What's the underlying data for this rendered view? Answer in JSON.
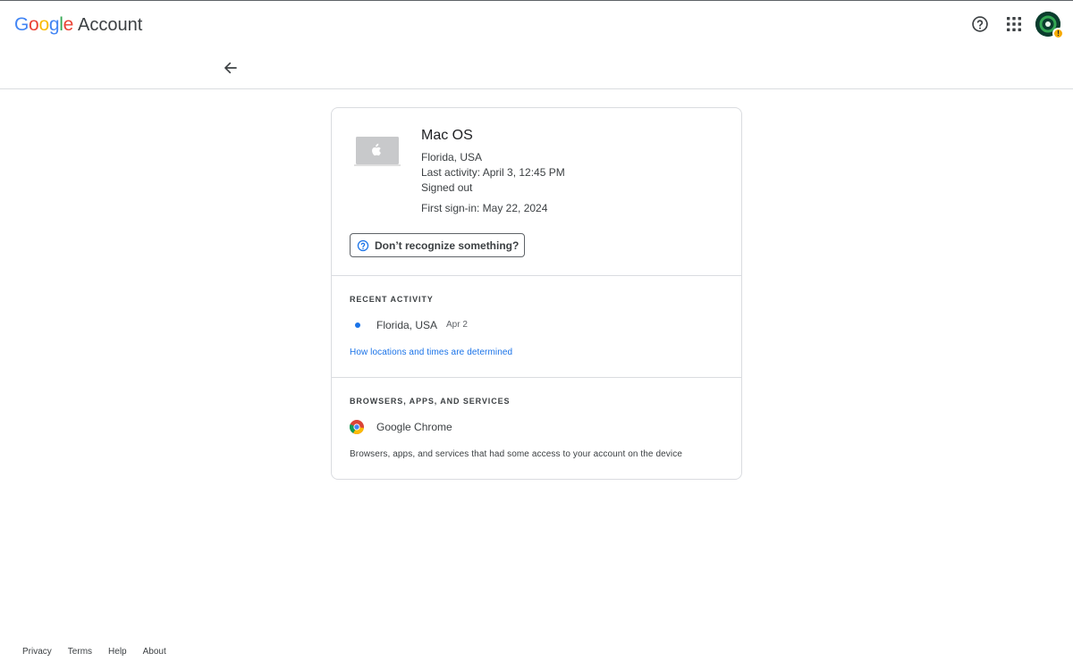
{
  "header": {
    "brand_letters": [
      {
        "char": "G",
        "color": "#4285F4"
      },
      {
        "char": "o",
        "color": "#EA4335"
      },
      {
        "char": "o",
        "color": "#FBBC05"
      },
      {
        "char": "g",
        "color": "#4285F4"
      },
      {
        "char": "l",
        "color": "#34A853"
      },
      {
        "char": "e",
        "color": "#EA4335"
      }
    ],
    "product": "Account",
    "icons": [
      "help-icon",
      "apps-grid-icon",
      "avatar"
    ],
    "avatar_badge": "!"
  },
  "nav": {
    "back_icon": "arrow-back-icon"
  },
  "device": {
    "title": "Mac OS",
    "location": "Florida, USA",
    "last_activity": "Last activity: April 3, 12:45 PM",
    "status": "Signed out",
    "first_signin": "First sign-in: May 22, 2024",
    "icon": "laptop-apple-icon"
  },
  "help_button": {
    "label": "Don’t recognize something?",
    "icon": "help-circle-icon"
  },
  "recent_activity": {
    "title": "RECENT ACTIVITY",
    "items": [
      {
        "location": "Florida, USA",
        "date": "Apr 2"
      }
    ],
    "link": "How locations and times are determined"
  },
  "apps": {
    "title": "BROWSERS, APPS, AND SERVICES",
    "items": [
      {
        "name": "Google Chrome",
        "icon": "chrome-icon"
      }
    ],
    "description": "Browsers, apps, and services that had some access to your account on the device"
  },
  "footer": {
    "links": [
      "Privacy",
      "Terms",
      "Help",
      "About"
    ]
  },
  "colors": {
    "link": "#1a73e8",
    "border": "#dadce0",
    "text": "#3c4043",
    "badge": "#f9ab00"
  }
}
